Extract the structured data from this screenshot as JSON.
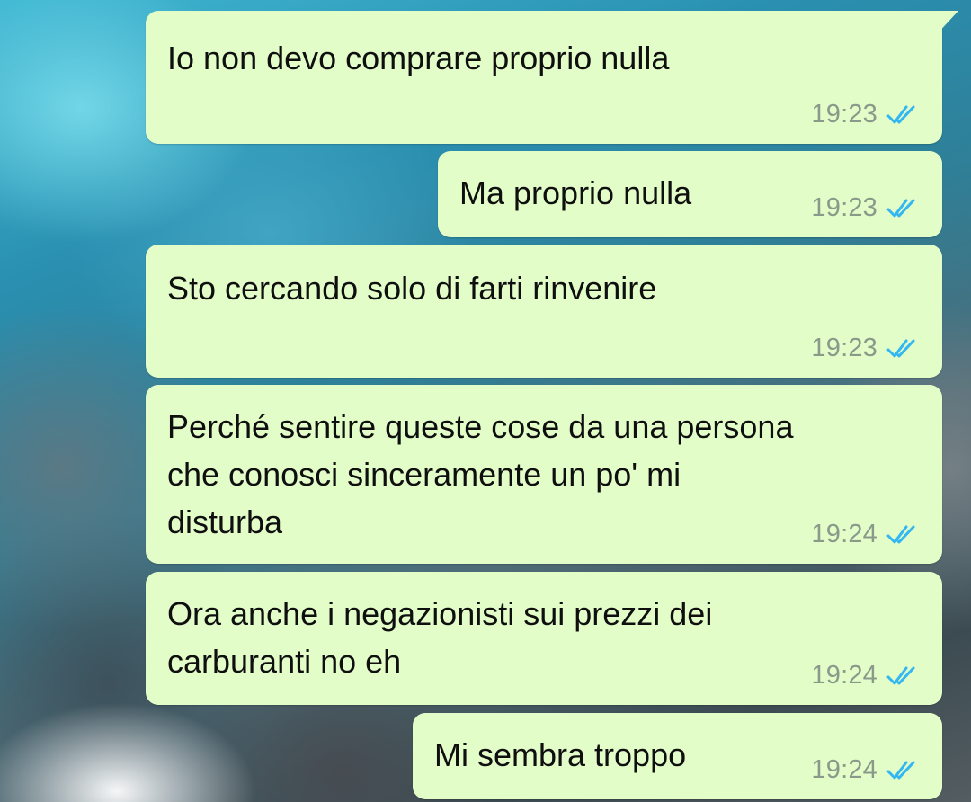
{
  "messages": [
    {
      "text": "Io non devo comprare proprio nulla",
      "time": "19:23",
      "status_icon": "double-check-read-icon"
    },
    {
      "text": "Ma proprio nulla",
      "time": "19:23",
      "status_icon": "double-check-read-icon"
    },
    {
      "text": "Sto cercando solo di farti rinvenire",
      "time": "19:23",
      "status_icon": "double-check-read-icon"
    },
    {
      "text": "Perché sentire queste cose da una persona\nche conosci sinceramente un po' mi\ndisturba",
      "time": "19:24",
      "status_icon": "double-check-read-icon"
    },
    {
      "text": "Ora anche i negazionisti sui prezzi dei\ncarburanti no eh",
      "time": "19:24",
      "status_icon": "double-check-read-icon"
    },
    {
      "text": "Mi sembra troppo",
      "time": "19:24",
      "status_icon": "double-check-read-icon"
    }
  ],
  "colors": {
    "bubble_background": "#e3fdc9",
    "read_tick": "#34b7f1",
    "time_text": "#8a9a8a"
  }
}
